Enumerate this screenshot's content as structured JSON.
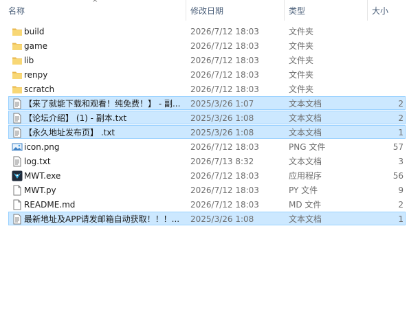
{
  "columns": {
    "name": "名称",
    "date": "修改日期",
    "type": "类型",
    "size": "大小"
  },
  "files": [
    {
      "name": "build",
      "date": "2026/7/12 18:03",
      "type": "文件夹",
      "size": "",
      "icon": "folder-icon",
      "selected": false
    },
    {
      "name": "game",
      "date": "2026/7/12 18:03",
      "type": "文件夹",
      "size": "",
      "icon": "folder-icon",
      "selected": false
    },
    {
      "name": "lib",
      "date": "2026/7/12 18:03",
      "type": "文件夹",
      "size": "",
      "icon": "folder-icon",
      "selected": false
    },
    {
      "name": "renpy",
      "date": "2026/7/12 18:03",
      "type": "文件夹",
      "size": "",
      "icon": "folder-icon",
      "selected": false
    },
    {
      "name": "scratch",
      "date": "2026/7/12 18:03",
      "type": "文件夹",
      "size": "",
      "icon": "folder-icon",
      "selected": false
    },
    {
      "name": "【来了就能下载和观看！纯免费！】 - 副...",
      "date": "2025/3/26 1:07",
      "type": "文本文档",
      "size": "2",
      "icon": "text-file-icon",
      "selected": true
    },
    {
      "name": "【论坛介绍】 (1) - 副本.txt",
      "date": "2025/3/26 1:08",
      "type": "文本文档",
      "size": "2",
      "icon": "text-file-icon",
      "selected": true
    },
    {
      "name": "【永久地址发布页】 .txt",
      "date": "2025/3/26 1:08",
      "type": "文本文档",
      "size": "1",
      "icon": "text-file-icon",
      "selected": true
    },
    {
      "name": "icon.png",
      "date": "2026/7/12 18:03",
      "type": "PNG 文件",
      "size": "57",
      "icon": "image-file-icon",
      "selected": false
    },
    {
      "name": "log.txt",
      "date": "2026/7/13 8:32",
      "type": "文本文档",
      "size": "3",
      "icon": "text-file-icon",
      "selected": false
    },
    {
      "name": "MWT.exe",
      "date": "2026/7/12 18:03",
      "type": "应用程序",
      "size": "56",
      "icon": "app-icon",
      "selected": false
    },
    {
      "name": "MWT.py",
      "date": "2026/7/12 18:03",
      "type": "PY 文件",
      "size": "9",
      "icon": "blank-file-icon",
      "selected": false
    },
    {
      "name": "README.md",
      "date": "2026/7/12 18:03",
      "type": "MD 文件",
      "size": "2",
      "icon": "blank-file-icon",
      "selected": false
    },
    {
      "name": "最新地址及APP请发邮箱自动获取！！！...",
      "date": "2025/3/26 1:08",
      "type": "文本文档",
      "size": "1",
      "icon": "text-file-icon",
      "selected": true
    }
  ],
  "colors": {
    "selection_bg": "#cce8ff",
    "selection_border": "#99d1ff",
    "folder": "#f8d775",
    "header_text": "#4c607a"
  }
}
